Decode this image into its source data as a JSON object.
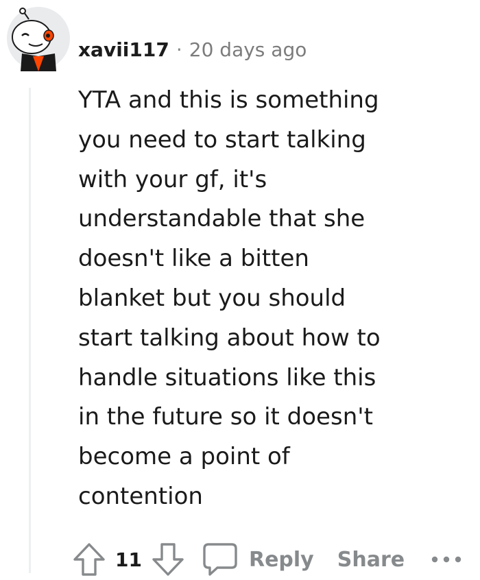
{
  "comment": {
    "avatar_icon": "snoo-avatar-icon",
    "username": "xavii117",
    "separator": "·",
    "timestamp": "20 days ago",
    "body": "YTA and this is something\nyou need to start talking\nwith your gf, it's\nunderstandable that she\ndoesn't like a bitten\nblanket but you should\nstart talking about how to\nhandle situations like this\nin the future so it doesn't\nbecome a point of\ncontention",
    "score": "11",
    "reply_label": "Reply",
    "share_label": "Share",
    "icons": {
      "upvote": "upvote-arrow-icon",
      "downvote": "downvote-arrow-icon",
      "reply": "comment-bubble-icon",
      "more": "more-options-icon"
    },
    "colors": {
      "muted": "#878a8c",
      "text": "#1a1a1b",
      "thread_line": "#edeff1",
      "avatar_accent": "#ff4500"
    }
  }
}
